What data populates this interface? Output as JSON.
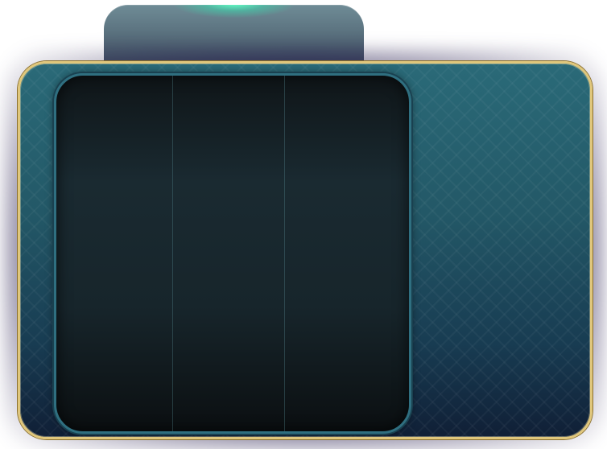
{
  "scene": {
    "name": "slot-machine-frame",
    "reel_count": 3,
    "colors": {
      "frame_border": "#e0c77c",
      "panel_top": "#2a6a78",
      "panel_bottom": "#101f36",
      "reel_window_border": "#2f6f80",
      "reel_background": "#17252b",
      "tab_top": "#6f8c96",
      "tab_bottom": "#3d4a5e",
      "tab_glow": "#60ffc4"
    }
  }
}
